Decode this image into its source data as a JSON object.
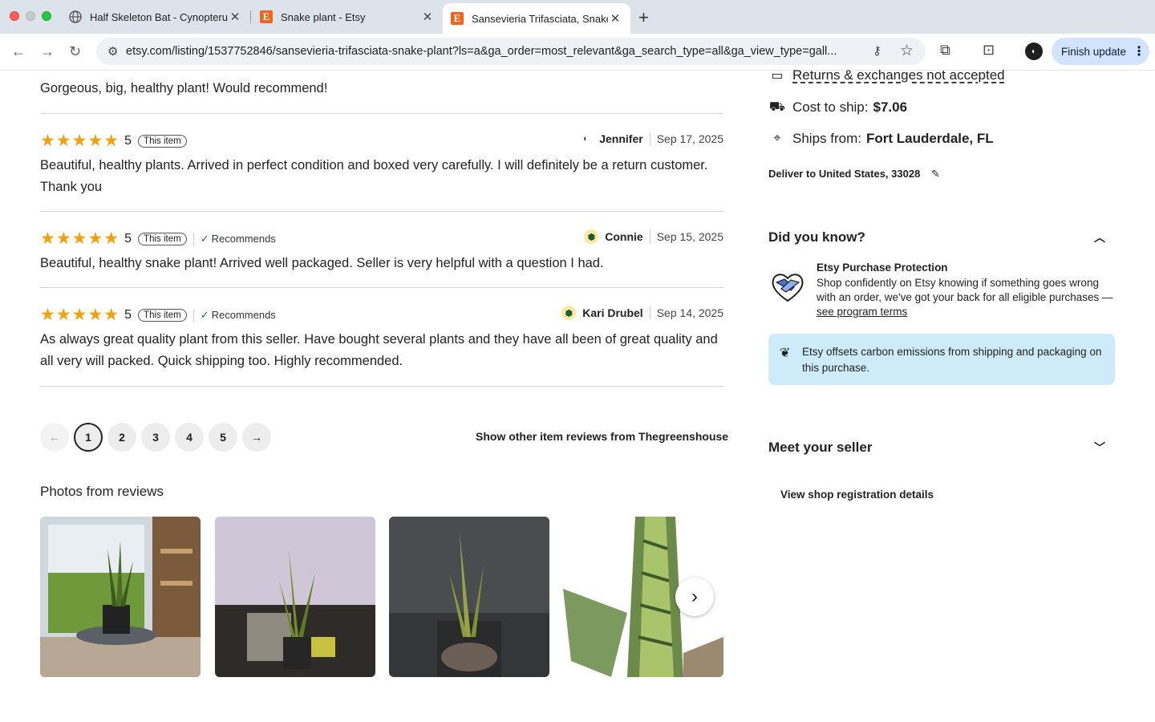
{
  "browser": {
    "tabs": [
      {
        "title": "Half Skeleton Bat - Cynopterus",
        "close": "✕"
      },
      {
        "title": "Snake plant - Etsy",
        "close": "✕"
      },
      {
        "title": "Sansevieria Trifasciata, Snake",
        "close": "✕"
      }
    ],
    "new_tab": "+",
    "url": "etsy.com/listing/1537752846/sansevieria-trifasciata-snake-plant?ls=a&ga_order=most_relevant&ga_search_type=all&ga_view_type=gall...",
    "update_button": "Finish update",
    "etsy_favicon": "E"
  },
  "reviews": {
    "partial_text": "Gorgeous, big, healthy plant! Would recommend!",
    "items": [
      {
        "stars": "★★★★★",
        "rating": "5",
        "badge": "This item",
        "recommends": "",
        "name": "Jennifer",
        "date": "Sep 17, 2025",
        "text": "Beautiful, healthy plants. Arrived in perfect condition and boxed very carefully. I will definitely be a return customer. Thank you"
      },
      {
        "stars": "★★★★★",
        "rating": "5",
        "badge": "This item",
        "recommends": "Recommends",
        "name": "Connie",
        "date": "Sep 15, 2025",
        "text": "Beautiful, healthy snake plant! Arrived well packaged. Seller is very helpful with a question I had."
      },
      {
        "stars": "★★★★★",
        "rating": "5",
        "badge": "This item",
        "recommends": "Recommends",
        "name": "Kari Drubel",
        "date": "Sep 14, 2025",
        "text": "As always great quality plant from this seller. Have bought several plants and they have all been of great quality and all very will packed. Quick shipping too. Highly recommended."
      }
    ],
    "pagination": {
      "prev": "←",
      "pages": [
        "1",
        "2",
        "3",
        "4",
        "5"
      ],
      "current": "1",
      "next": "→"
    },
    "other_reviews_link": "Show other item reviews from Thegreenshouse",
    "photos_title": "Photos from reviews"
  },
  "sidebar": {
    "returns": "Returns & exchanges not accepted",
    "cost_label": "Cost to ship:",
    "cost_value": "$7.06",
    "ships_label": "Ships from:",
    "ships_value": "Fort Lauderdale, FL",
    "deliver": "Deliver to United States, 33028",
    "did_you_know": "Did you know?",
    "protection_title": "Etsy Purchase Protection",
    "protection_body": "Shop confidently on Etsy knowing if something goes wrong with an order, we've got your back for all eligible purchases — ",
    "protection_link": "see program terms",
    "carbon_text": "Etsy offsets carbon emissions from shipping and packaging on this purchase.",
    "meet_seller": "Meet your seller",
    "shop_registration": "View shop registration details"
  },
  "colors": {
    "star": "#f1a10b",
    "carbon_bg": "#cdebf9",
    "update_btn": "#d3e3fd",
    "etsy_orange": "#f1641e"
  }
}
